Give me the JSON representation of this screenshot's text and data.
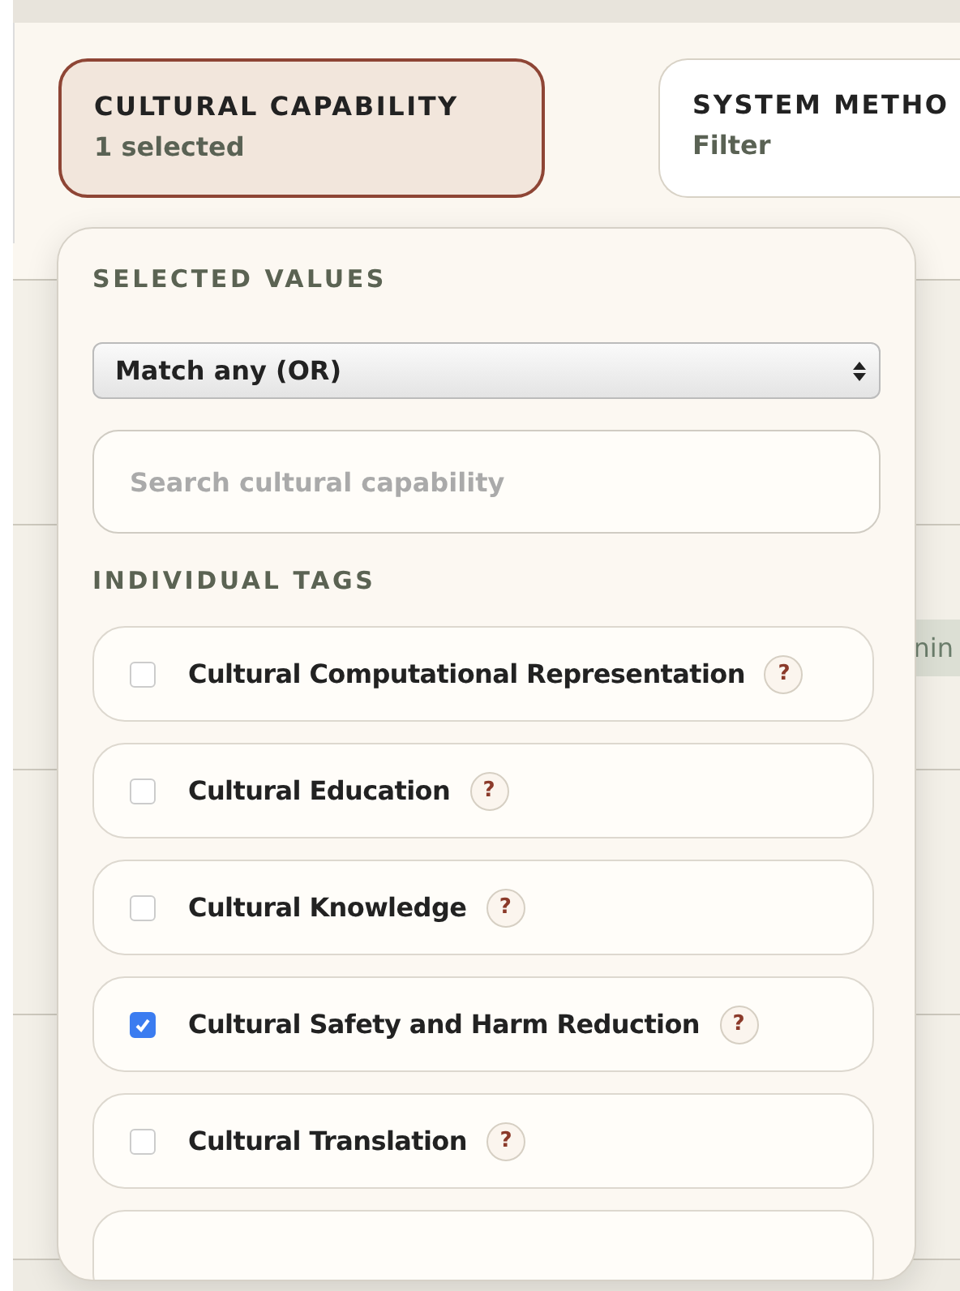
{
  "filters": [
    {
      "label": "CULTURAL CAPABILITY",
      "summary": "1 selected",
      "selected": true
    },
    {
      "label": "SYSTEM METHO",
      "summary": "Filter",
      "selected": false
    }
  ],
  "background_chip": "nin",
  "popup": {
    "selected_heading": "SELECTED VALUES",
    "match_mode": "Match any (OR)",
    "search": {
      "placeholder": "Search cultural capability"
    },
    "tags_heading": "INDIVIDUAL TAGS",
    "tags": [
      {
        "label": "Cultural Computational Representation",
        "checked": false,
        "help": "?"
      },
      {
        "label": "Cultural Education",
        "checked": false,
        "help": "?"
      },
      {
        "label": "Cultural Knowledge",
        "checked": false,
        "help": "?"
      },
      {
        "label": "Cultural Safety and Harm Reduction",
        "checked": true,
        "help": "?"
      },
      {
        "label": "Cultural Translation",
        "checked": false,
        "help": "?"
      }
    ],
    "more_tags_cut": true
  }
}
